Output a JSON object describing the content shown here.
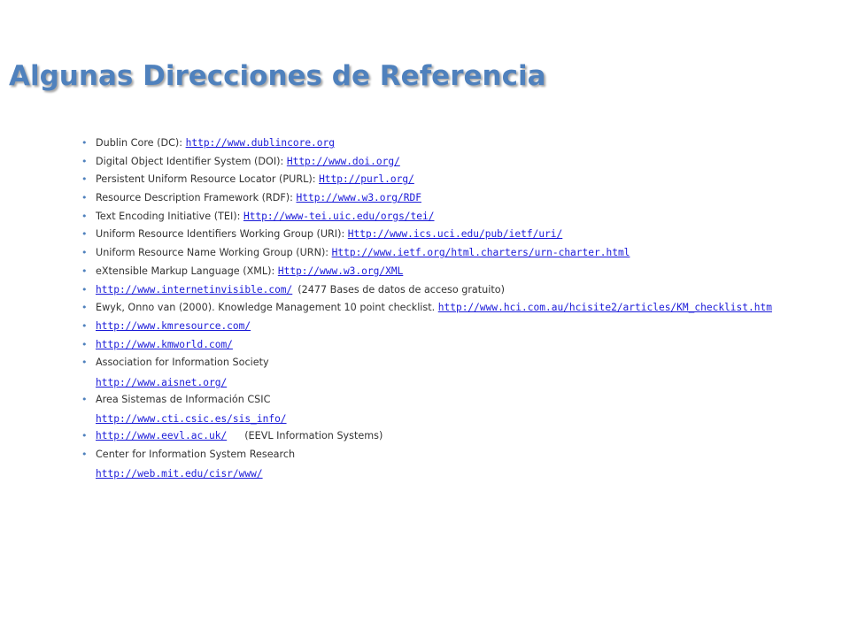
{
  "title": "Algunas Direcciones de Referencia",
  "bullet_color": "#4f81bd",
  "title_color": "#4f81bd",
  "link_color": "#1a1ad8",
  "items": [
    {
      "label": "Dublin Core (DC): ",
      "link": "http://www.dublincore.org"
    },
    {
      "label": "Digital Object Identifier System (DOI): ",
      "link": "Http://www.doi.org/"
    },
    {
      "label": "Persistent Uniform Resource Locator (PURL): ",
      "link": "Http://purl.org/"
    },
    {
      "label": "Resource Description Framework (RDF): ",
      "link": "Http://www.w3.org/RDF"
    },
    {
      "label": "Text Encoding Initiative (TEI): ",
      "link": "Http://www-tei.uic.edu/orgs/tei/"
    },
    {
      "label": "Uniform Resource Identifiers Working Group (URI): ",
      "link": "Http://www.ics.uci.edu/pub/ietf/uri/"
    },
    {
      "label": "Uniform Resource Name Working Group (URN): ",
      "link": "Http://www.ietf.org/html.charters/urn-charter.html"
    },
    {
      "label": "eXtensible Markup Language (XML): ",
      "link": "Http://www.w3.org/XML"
    },
    {
      "link": "http://www.internetinvisible.com/",
      "note": "(2477 Bases de datos de acceso gratuito)"
    },
    {
      "label": "Ewyk, Onno van (2000). Knowledge Management 10 point checklist. ",
      "link": "http://www.hci.com.au/hcisite2/articles/KM_checklist.htm"
    },
    {
      "link": "http://www.kmresource.com/"
    },
    {
      "link": "http://www.kmworld.com/"
    },
    {
      "label": "Association for Information Society",
      "link": "http://www.aisnet.org/"
    },
    {
      "label": "Area Sistemas de Información CSIC",
      "link": "http://www.cti.csic.es/sis_info/"
    },
    {
      "link": "http://www.eevl.ac.uk/",
      "note": "(EEVL Information Systems)"
    },
    {
      "label": "Center for Information System Research",
      "link": "http://web.mit.edu/cisr/www/"
    }
  ]
}
